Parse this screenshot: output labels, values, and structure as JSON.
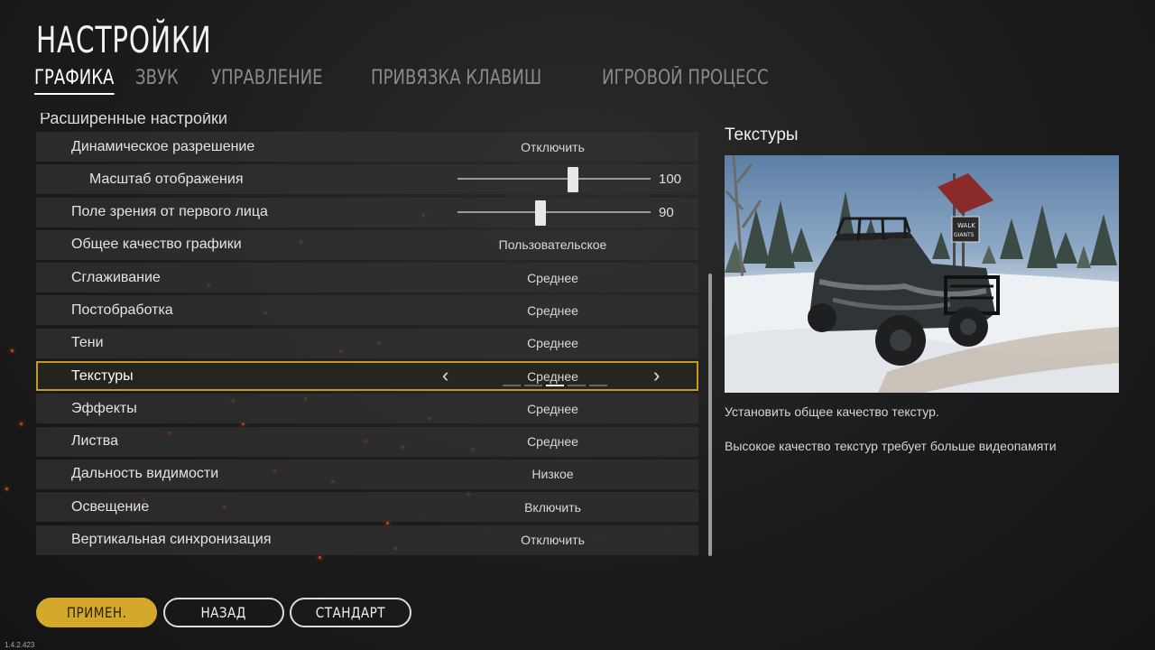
{
  "title": "НАСТРОЙКИ",
  "tabs": [
    {
      "label": "ГРАФИКА"
    },
    {
      "label": "ЗВУК"
    },
    {
      "label": "УПРАВЛЕНИЕ"
    },
    {
      "label": "ПРИВЯЗКА КЛАВИШ"
    },
    {
      "label": "ИГРОВОЙ ПРОЦЕСС"
    }
  ],
  "active_tab": "ГРАФИКА",
  "section_title": "Расширенные настройки",
  "settings": {
    "dynamic_resolution": {
      "label": "Динамическое разрешение",
      "value": "Отключить"
    },
    "render_scale": {
      "label": "Масштаб отображения",
      "value": "100",
      "level": 0.6
    },
    "fov": {
      "label": "Поле зрения от первого лица",
      "value": "90",
      "level": 0.43
    },
    "overall_quality": {
      "label": "Общее качество графики",
      "value": "Пользовательское"
    },
    "antialiasing": {
      "label": "Сглаживание",
      "value": "Среднее"
    },
    "postprocessing": {
      "label": "Постобработка",
      "value": "Среднее"
    },
    "shadows": {
      "label": "Тени",
      "value": "Среднее"
    },
    "textures": {
      "label": "Текстуры",
      "value": "Среднее",
      "step": 3,
      "steps": 5
    },
    "effects": {
      "label": "Эффекты",
      "value": "Среднее"
    },
    "foliage": {
      "label": "Листва",
      "value": "Среднее"
    },
    "view_distance": {
      "label": "Дальность видимости",
      "value": "Низкое"
    },
    "lighting": {
      "label": "Освещение",
      "value": "Включить"
    },
    "vsync": {
      "label": "Вертикальная синхронизация",
      "value": "Отключить"
    }
  },
  "info": {
    "title": "Текстуры",
    "line1": "Установить общее качество текстур.",
    "line2": "Высокое качество текстур требует больше видеопамяти",
    "sign_text_1": "WALK",
    "sign_text_2": "GIANTS"
  },
  "buttons": {
    "apply": "ПРИМЕН.",
    "back": "НАЗАД",
    "default": "СТАНДАРТ"
  },
  "version": "1.4.2.423",
  "colors": {
    "accent": "#d4a82a",
    "selected_outline": "#c49a22",
    "ember": "#d2401c"
  }
}
